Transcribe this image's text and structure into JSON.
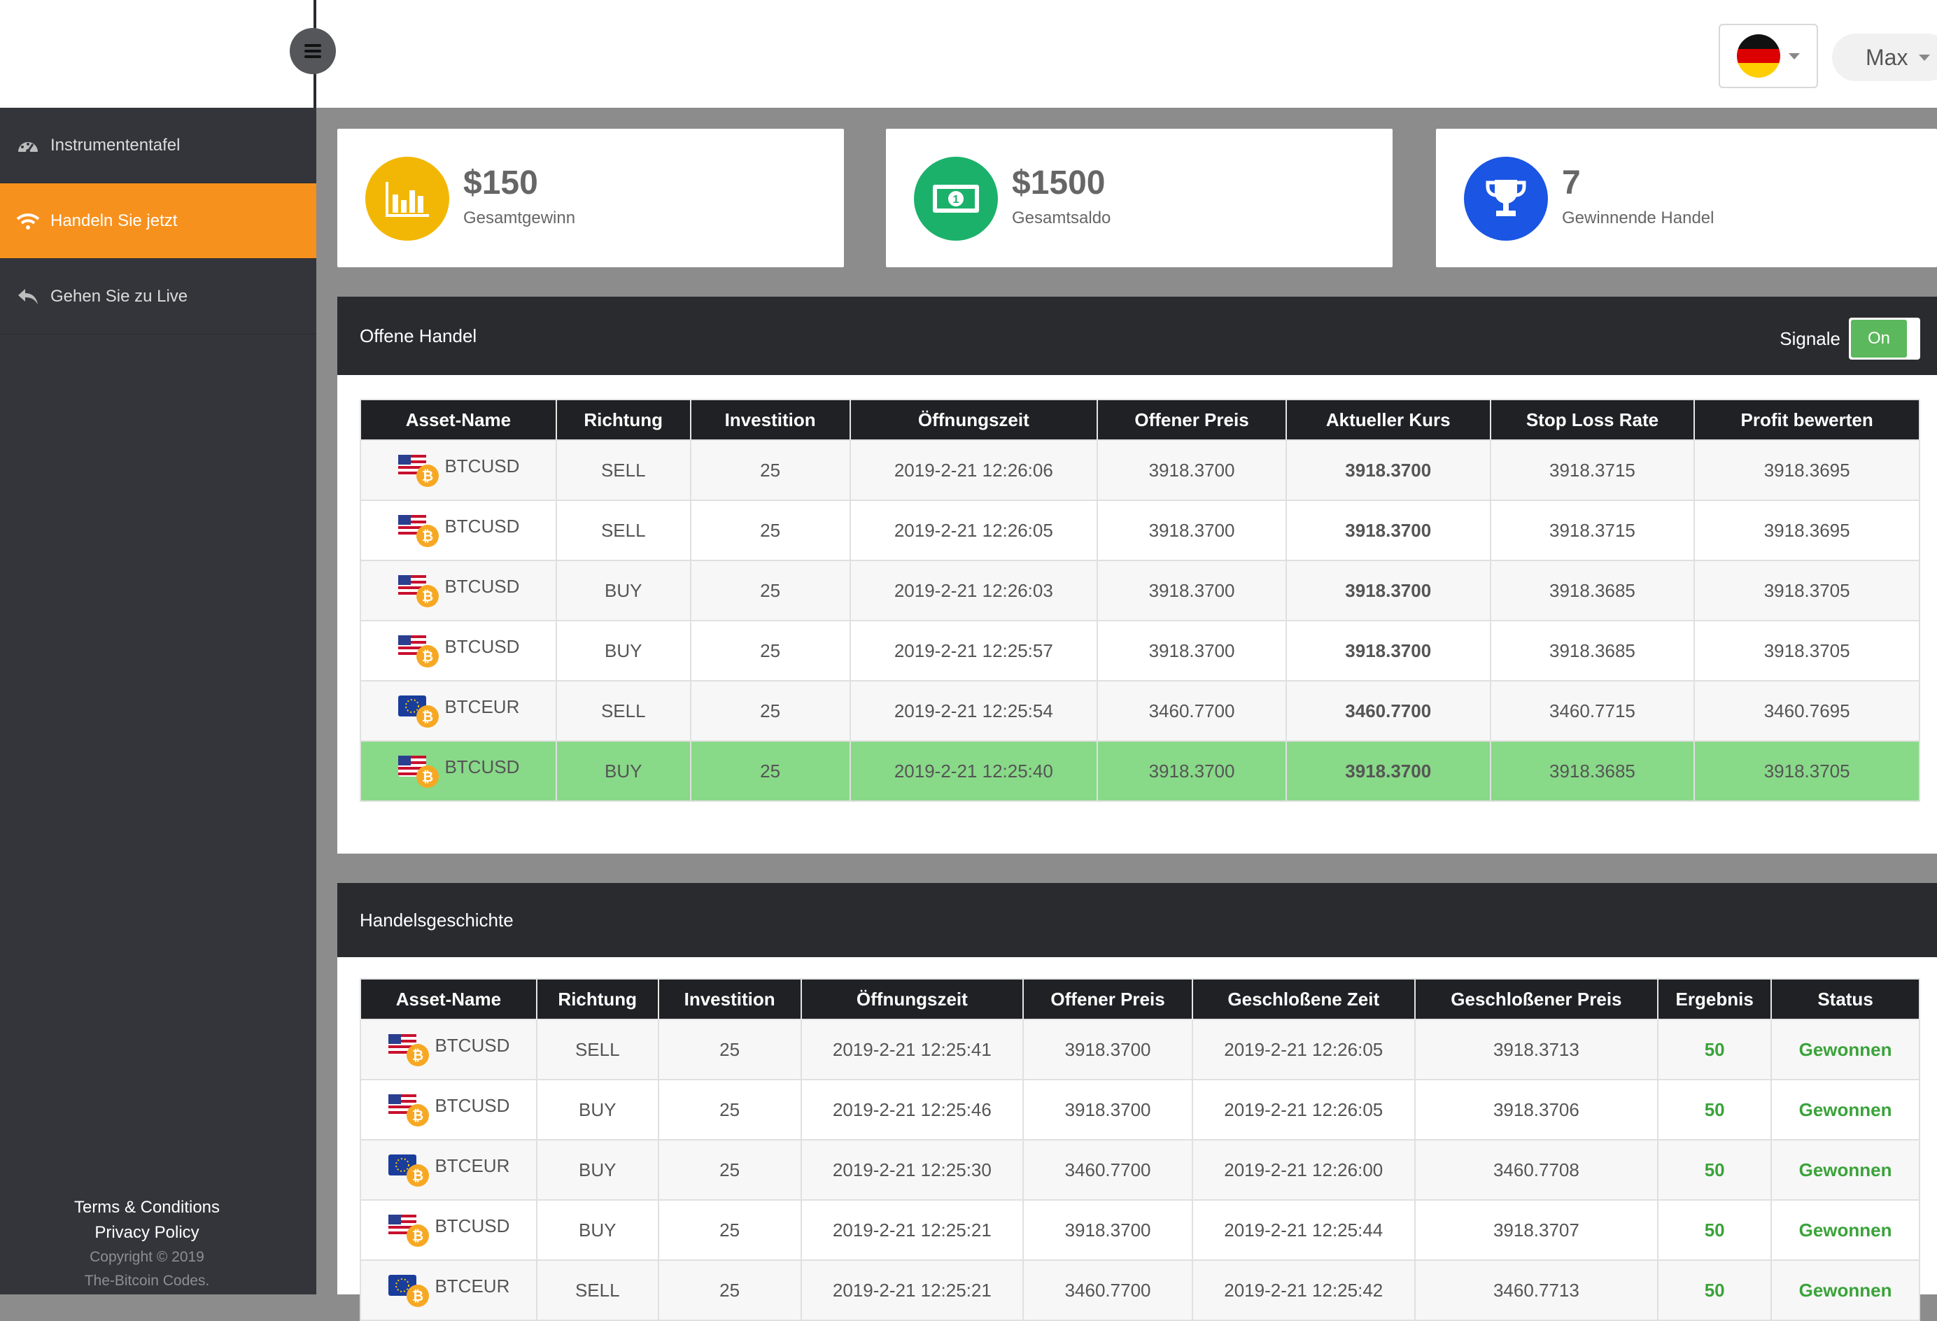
{
  "header": {
    "menu_icon": "hamburger-icon",
    "language_flag": "flag-germany-icon",
    "user_name": "Max"
  },
  "sidebar": {
    "items": [
      {
        "label": "Instrumententafel",
        "icon": "dashboard-gauge-icon"
      },
      {
        "label": "Handeln Sie jetzt",
        "icon": "wifi-signal-icon",
        "active": true
      },
      {
        "label": "Gehen Sie zu Live",
        "icon": "reply-arrow-icon"
      }
    ],
    "footer": {
      "terms": "Terms & Conditions",
      "privacy": "Privacy Policy",
      "copyright": "Copyright © 2019",
      "site": "The-Bitcoin Codes."
    }
  },
  "stats": [
    {
      "value": "$150",
      "label": "Gesamtgewinn",
      "icon": "bar-chart-icon",
      "color": "#f2b705"
    },
    {
      "value": "$1500",
      "label": "Gesamtsaldo",
      "icon": "money-bill-icon",
      "color": "#1cb16b"
    },
    {
      "value": "7",
      "label": "Gewinnende Handel",
      "icon": "trophy-icon",
      "color": "#1a55e3"
    }
  ],
  "open_trades": {
    "title": "Offene Handel",
    "signals_label": "Signale",
    "signals_toggle": "On",
    "columns": [
      "Asset-Name",
      "Richtung",
      "Investition",
      "Öffnungszeit",
      "Offener Preis",
      "Aktueller Kurs",
      "Stop Loss Rate",
      "Profit bewerten"
    ],
    "rows": [
      {
        "asset": "BTCUSD",
        "direction": "SELL",
        "investment": "25",
        "open_time": "2019-2-21 12:26:06",
        "open_price": "3918.3700",
        "current": "3918.3700",
        "stop_loss": "3918.3715",
        "profit": "3918.3695"
      },
      {
        "asset": "BTCUSD",
        "direction": "SELL",
        "investment": "25",
        "open_time": "2019-2-21 12:26:05",
        "open_price": "3918.3700",
        "current": "3918.3700",
        "stop_loss": "3918.3715",
        "profit": "3918.3695"
      },
      {
        "asset": "BTCUSD",
        "direction": "BUY",
        "investment": "25",
        "open_time": "2019-2-21 12:26:03",
        "open_price": "3918.3700",
        "current": "3918.3700",
        "stop_loss": "3918.3685",
        "profit": "3918.3705"
      },
      {
        "asset": "BTCUSD",
        "direction": "BUY",
        "investment": "25",
        "open_time": "2019-2-21 12:25:57",
        "open_price": "3918.3700",
        "current": "3918.3700",
        "stop_loss": "3918.3685",
        "profit": "3918.3705"
      },
      {
        "asset": "BTCEUR",
        "direction": "SELL",
        "investment": "25",
        "open_time": "2019-2-21 12:25:54",
        "open_price": "3460.7700",
        "current": "3460.7700",
        "stop_loss": "3460.7715",
        "profit": "3460.7695"
      },
      {
        "asset": "BTCUSD",
        "direction": "BUY",
        "investment": "25",
        "open_time": "2019-2-21 12:25:40",
        "open_price": "3918.3700",
        "current": "3918.3700",
        "stop_loss": "3918.3685",
        "profit": "3918.3705"
      }
    ],
    "highlight_color": "#88d988"
  },
  "history": {
    "title": "Handelsgeschichte",
    "columns": [
      "Asset-Name",
      "Richtung",
      "Investition",
      "Öffnungszeit",
      "Offener Preis",
      "Geschloßene Zeit",
      "Geschloßener Preis",
      "Ergebnis",
      "Status"
    ],
    "rows": [
      {
        "asset": "BTCUSD",
        "direction": "SELL",
        "investment": "25",
        "open_time": "2019-2-21 12:25:41",
        "open_price": "3918.3700",
        "close_time": "2019-2-21 12:26:05",
        "close_price": "3918.3713",
        "result": "50",
        "status": "Gewonnen"
      },
      {
        "asset": "BTCUSD",
        "direction": "BUY",
        "investment": "25",
        "open_time": "2019-2-21 12:25:46",
        "open_price": "3918.3700",
        "close_time": "2019-2-21 12:26:05",
        "close_price": "3918.3706",
        "result": "50",
        "status": "Gewonnen"
      },
      {
        "asset": "BTCEUR",
        "direction": "BUY",
        "investment": "25",
        "open_time": "2019-2-21 12:25:30",
        "open_price": "3460.7700",
        "close_time": "2019-2-21 12:26:00",
        "close_price": "3460.7708",
        "result": "50",
        "status": "Gewonnen"
      },
      {
        "asset": "BTCUSD",
        "direction": "BUY",
        "investment": "25",
        "open_time": "2019-2-21 12:25:21",
        "open_price": "3918.3700",
        "close_time": "2019-2-21 12:25:44",
        "close_price": "3918.3707",
        "result": "50",
        "status": "Gewonnen"
      },
      {
        "asset": "BTCEUR",
        "direction": "SELL",
        "investment": "25",
        "open_time": "2019-2-21 12:25:21",
        "open_price": "3460.7700",
        "close_time": "2019-2-21 12:25:42",
        "close_price": "3460.7713",
        "result": "50",
        "status": "Gewonnen"
      }
    ],
    "win_color": "#3aa33a"
  }
}
